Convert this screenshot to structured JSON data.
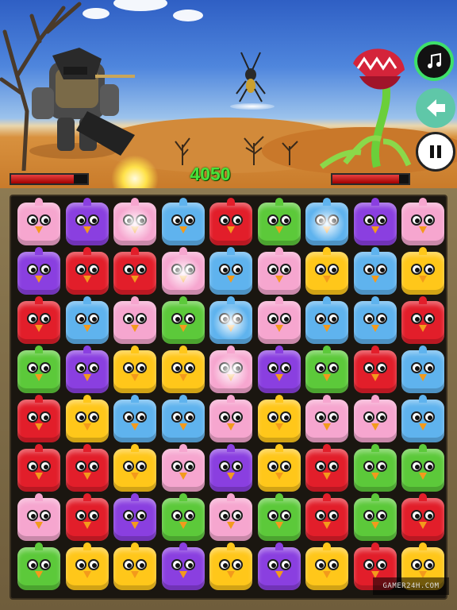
{
  "game": {
    "score": "4050",
    "player_hp": 0.82,
    "enemy_hp": 0.88,
    "watermark": "GAMER24H.COM"
  },
  "colors": {
    "pink": "#f6a6cf",
    "purple": "#8a3fe0",
    "blue": "#5fb3ee",
    "red": "#e21e2a",
    "green": "#5cc93a",
    "yellow": "#ffc71a"
  },
  "buttons": {
    "music": "music-note-icon",
    "back": "back-arrow-icon",
    "pause": "pause-icon"
  },
  "board": {
    "rows": [
      [
        "pink",
        "purple",
        "pink*",
        "blue",
        "red",
        "green",
        "blue*",
        "purple",
        "pink"
      ],
      [
        "purple",
        "red",
        "red",
        "pink*",
        "blue",
        "pink",
        "yellow",
        "blue",
        "yellow"
      ],
      [
        "red",
        "blue",
        "pink",
        "green",
        "blue*",
        "pink",
        "blue",
        "blue",
        "red"
      ],
      [
        "green",
        "purple",
        "yellow",
        "yellow",
        "pink*",
        "purple",
        "green",
        "red",
        "blue"
      ],
      [
        "red",
        "yellow",
        "blue",
        "blue",
        "pink",
        "yellow",
        "pink",
        "pink",
        "blue"
      ],
      [
        "red",
        "red",
        "yellow",
        "pink",
        "purple",
        "yellow",
        "red",
        "green",
        "green"
      ],
      [
        "pink",
        "red",
        "purple",
        "green",
        "pink",
        "green",
        "red",
        "green",
        "red"
      ],
      [
        "green",
        "yellow",
        "yellow",
        "purple",
        "yellow",
        "purple",
        "yellow",
        "red",
        "yellow"
      ]
    ]
  }
}
